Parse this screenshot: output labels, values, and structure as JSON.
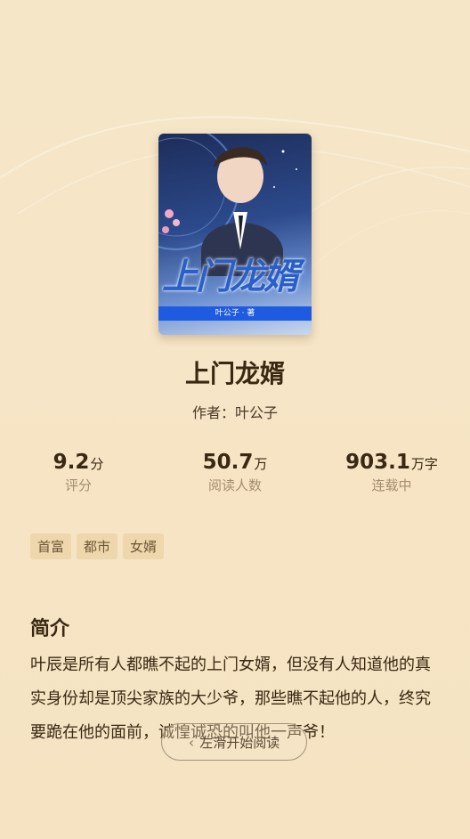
{
  "book": {
    "cover_title": "上门龙婿",
    "cover_author_line": "叶公子 · 著",
    "title": "上门龙婿",
    "author": "作者：叶公子"
  },
  "stats": [
    {
      "value": "9.2",
      "unit": "分",
      "label": "评分"
    },
    {
      "value": "50.7",
      "unit": "万",
      "label": "阅读人数"
    },
    {
      "value": "903.1",
      "unit": "万字",
      "label": "连载中"
    }
  ],
  "tags": [
    "首富",
    "都市",
    "女婿"
  ],
  "intro": {
    "heading": "简介",
    "text": "叶辰是所有人都瞧不起的上门女婿，但没有人知道他的真实身份却是顶尖家族的大少爷，那些瞧不起他的人，终究要跪在他的面前，诚惶诚恐的叫他一声爷！"
  },
  "start_reading": {
    "label": "左滑开始阅读",
    "icon": "chevron-left-icon"
  },
  "colors": {
    "background": "#f5e6c8",
    "tag_bg": "#eed7ac",
    "muted": "#a58e6e"
  }
}
